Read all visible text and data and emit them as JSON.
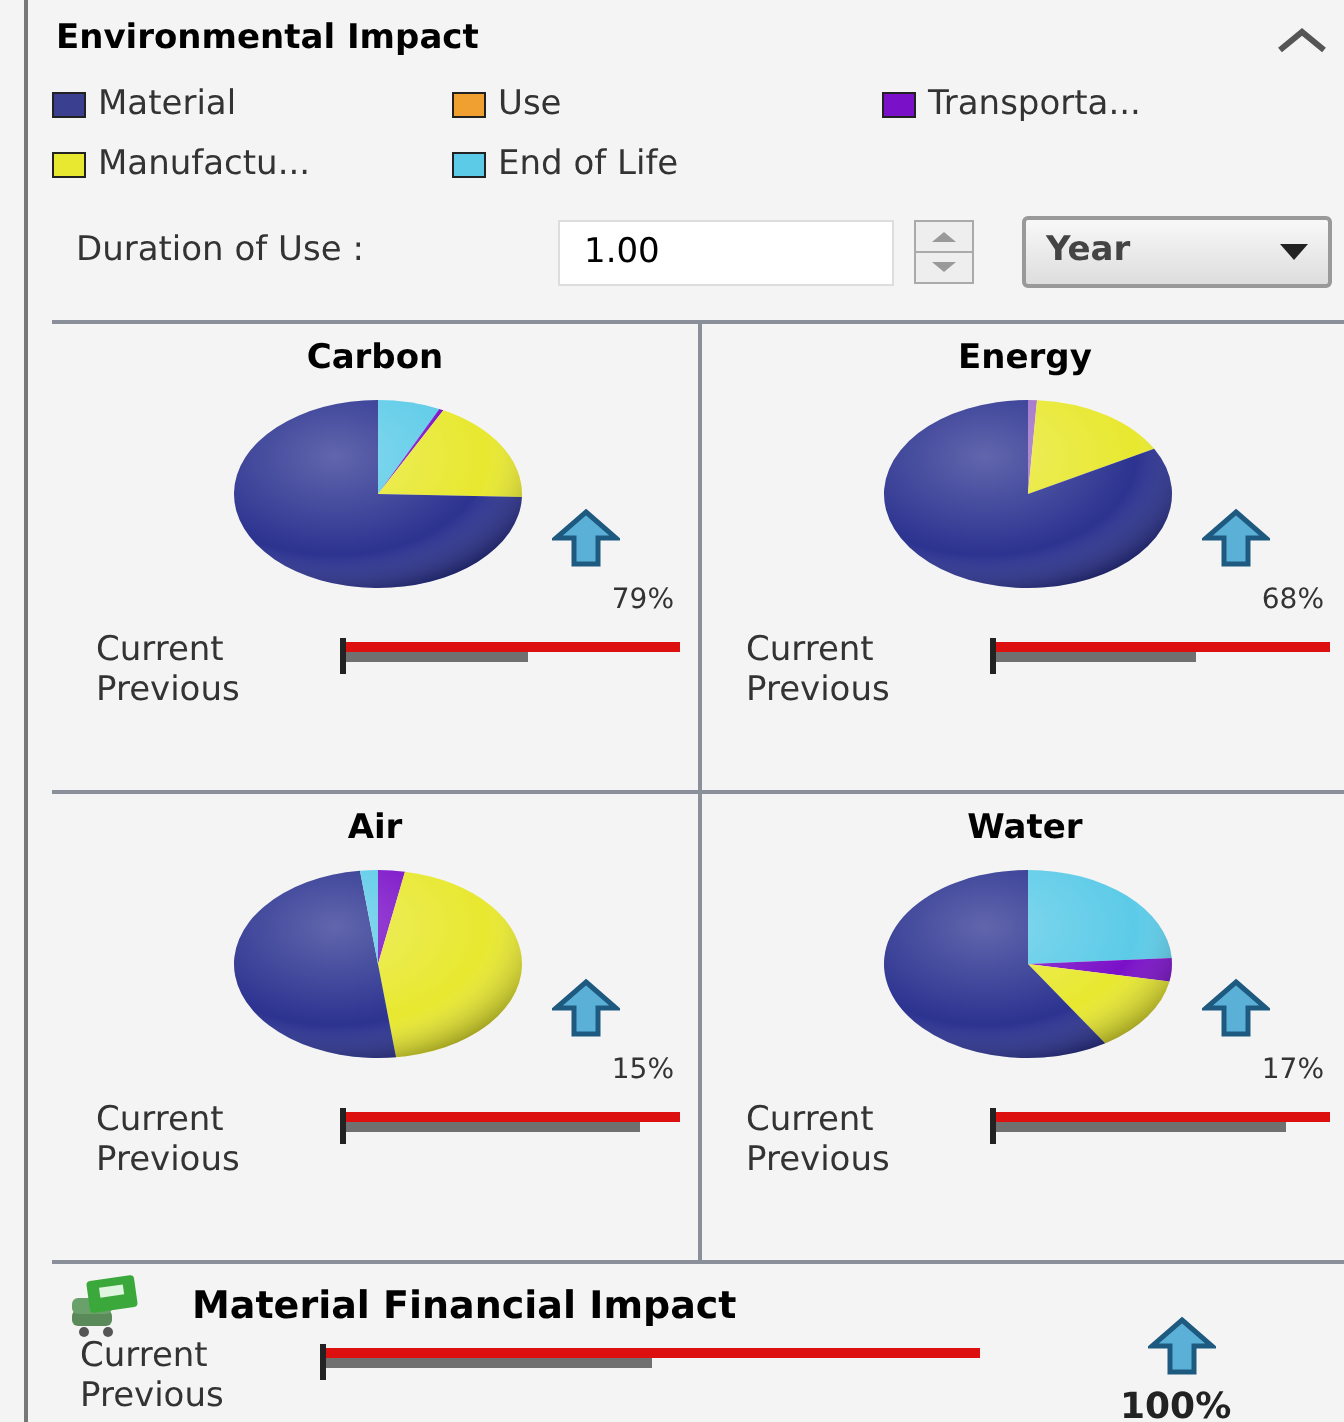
{
  "section": {
    "title": "Environmental Impact",
    "expanded": true
  },
  "legend": [
    {
      "label": "Material",
      "color": "#3a3f8f"
    },
    {
      "label": "Use",
      "color": "#f0a030"
    },
    {
      "label": "Transporta...",
      "color": "#7a10c8"
    },
    {
      "label": "Manufactu...",
      "color": "#e8e830"
    },
    {
      "label": "End of Life",
      "color": "#5ccbe8"
    }
  ],
  "duration": {
    "label": "Duration of Use :",
    "value": "1.00",
    "unit": "Year"
  },
  "panels": [
    {
      "title": "Carbon",
      "change": "79%",
      "current": {
        "label": "Current"
      },
      "previous": {
        "label": "Previous",
        "level": 0.55
      }
    },
    {
      "title": "Energy",
      "change": "68%",
      "current": {
        "label": "Current"
      },
      "previous": {
        "label": "Previous",
        "level": 0.6
      }
    },
    {
      "title": "Air",
      "change": "15%",
      "current": {
        "label": "Current"
      },
      "previous": {
        "label": "Previous",
        "level": 0.88
      }
    },
    {
      "title": "Water",
      "change": "17%",
      "current": {
        "label": "Current"
      },
      "previous": {
        "label": "Previous",
        "level": 0.87
      }
    }
  ],
  "financial": {
    "title": "Material Financial Impact",
    "change": "100%",
    "current": {
      "label": "Current"
    },
    "previous": {
      "label": "Previous",
      "level": 0.5
    }
  }
}
